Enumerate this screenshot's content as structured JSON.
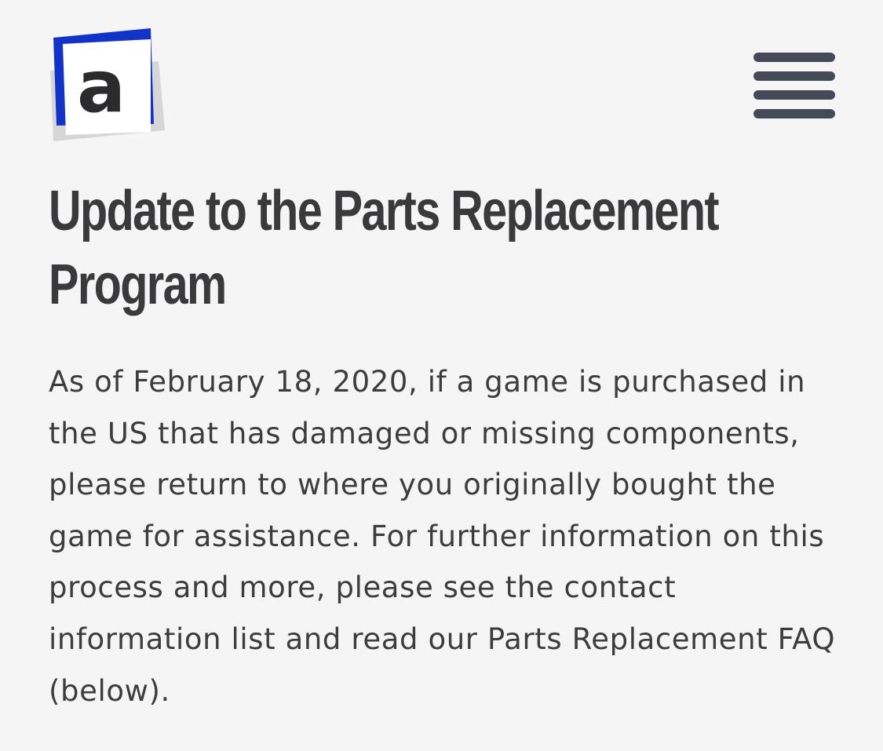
{
  "header": {
    "logo_letter": "a",
    "menu_icon": "hamburger-menu-icon"
  },
  "article": {
    "title": "Update to the Parts Replacement Program",
    "body": "As of February 18, 2020, if a game is purchased in the US that has damaged or missing components, please return to where you originally bought the game for assistance. For further information on this process and more, please see the contact information list and read our Parts Replacement FAQ (below)."
  },
  "colors": {
    "background": "#f5f5f5",
    "logo_accent": "#1133c8",
    "logo_shadow": "#d6d6d6",
    "text": "#3a3a3c",
    "menu_icon": "#454a58"
  }
}
